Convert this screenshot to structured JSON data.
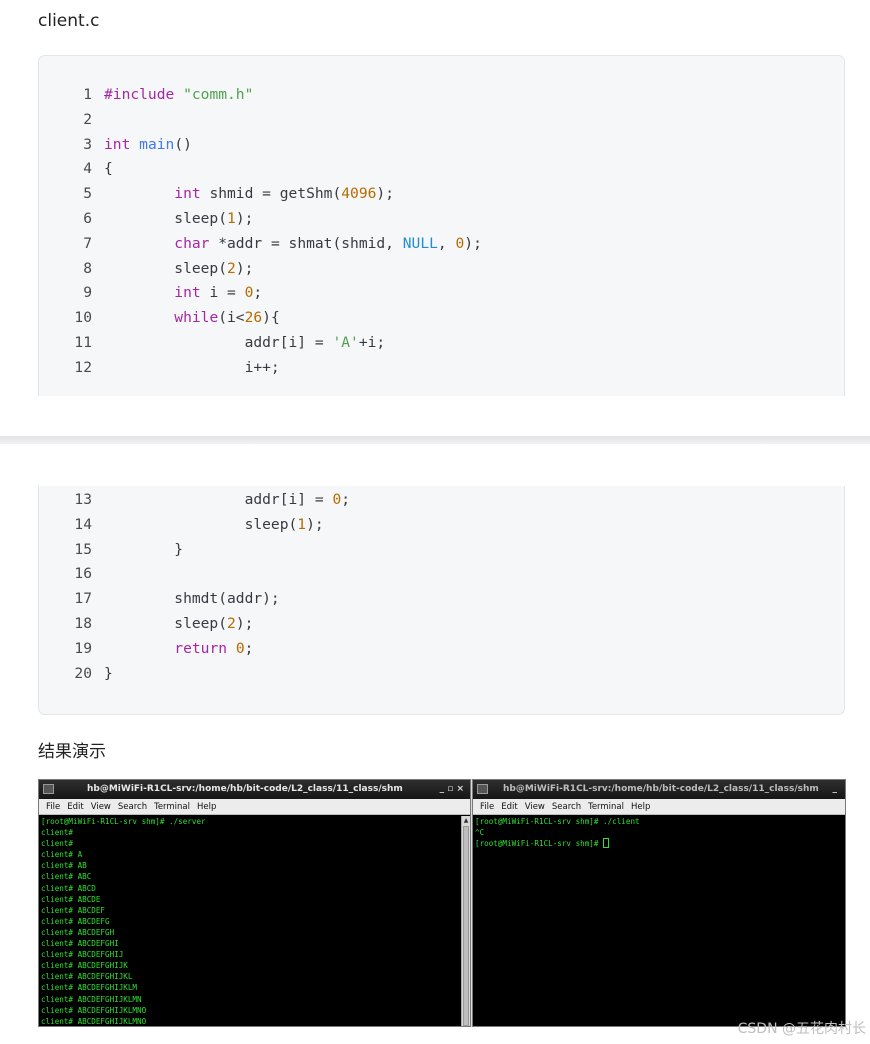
{
  "headings": {
    "file": "client.c",
    "result": "结果演示"
  },
  "code_part1": [
    {
      "n": "1",
      "html": "<span class=\"kw\">#include</span> <span class=\"st\">\"comm.h\"</span>"
    },
    {
      "n": "2",
      "html": ""
    },
    {
      "n": "3",
      "html": "<span class=\"ty\">int</span> <span class=\"fn\">main</span>()"
    },
    {
      "n": "4",
      "html": "{"
    },
    {
      "n": "5",
      "html": "        <span class=\"ty\">int</span> shmid = getShm(<span class=\"nm\">4096</span>);"
    },
    {
      "n": "6",
      "html": "        sleep(<span class=\"nm\">1</span>);"
    },
    {
      "n": "7",
      "html": "        <span class=\"ty\">char</span> *addr = shmat(shmid, <span class=\"mc\">NULL</span>, <span class=\"nm\">0</span>);"
    },
    {
      "n": "8",
      "html": "        sleep(<span class=\"nm\">2</span>);"
    },
    {
      "n": "9",
      "html": "        <span class=\"ty\">int</span> i = <span class=\"nm\">0</span>;"
    },
    {
      "n": "10",
      "html": "        <span class=\"kw\">while</span>(i&lt;<span class=\"nm\">26</span>){"
    },
    {
      "n": "11",
      "html": "                addr[i] = <span class=\"st\">'A'</span>+i;"
    },
    {
      "n": "12",
      "html": "                i++;"
    }
  ],
  "code_part2": [
    {
      "n": "13",
      "html": "                addr[i] = <span class=\"nm\">0</span>;"
    },
    {
      "n": "14",
      "html": "                sleep(<span class=\"nm\">1</span>);"
    },
    {
      "n": "15",
      "html": "        }"
    },
    {
      "n": "16",
      "html": ""
    },
    {
      "n": "17",
      "html": "        shmdt(addr);"
    },
    {
      "n": "18",
      "html": "        sleep(<span class=\"nm\">2</span>);"
    },
    {
      "n": "19",
      "html": "        <span class=\"kw\">return</span> <span class=\"nm\">0</span>;"
    },
    {
      "n": "20",
      "html": "}"
    }
  ],
  "terminal_left": {
    "title": "hb@MiWiFi-R1CL-srv:/home/hb/bit-code/L2_class/11_class/shm",
    "buttons": "_ ▫ ×",
    "menu": [
      "File",
      "Edit",
      "View",
      "Search",
      "Terminal",
      "Help"
    ],
    "lines": [
      "[root@MiWiFi-R1CL-srv shm]# ./server",
      "client#",
      "client#",
      "client# A",
      "client# AB",
      "client# ABC",
      "client# ABCD",
      "client# ABCDE",
      "client# ABCDEF",
      "client# ABCDEFG",
      "client# ABCDEFGH",
      "client# ABCDEFGHI",
      "client# ABCDEFGHIJ",
      "client# ABCDEFGHIJK",
      "client# ABCDEFGHIJKL",
      "client# ABCDEFGHIJKLM",
      "client# ABCDEFGHIJKLMN",
      "client# ABCDEFGHIJKLMNO",
      "client# ABCDEFGHIJKLMNO"
    ]
  },
  "terminal_right": {
    "title": "hb@MiWiFi-R1CL-srv:/home/hb/bit-code/L2_class/11_class/shm",
    "buttons": "_",
    "menu": [
      "File",
      "Edit",
      "View",
      "Search",
      "Terminal",
      "Help"
    ],
    "lines": [
      "[root@MiWiFi-R1CL-srv shm]# ./client",
      "^C",
      "[root@MiWiFi-R1CL-srv shm]# "
    ]
  },
  "watermark": "CSDN @五花肉村长"
}
